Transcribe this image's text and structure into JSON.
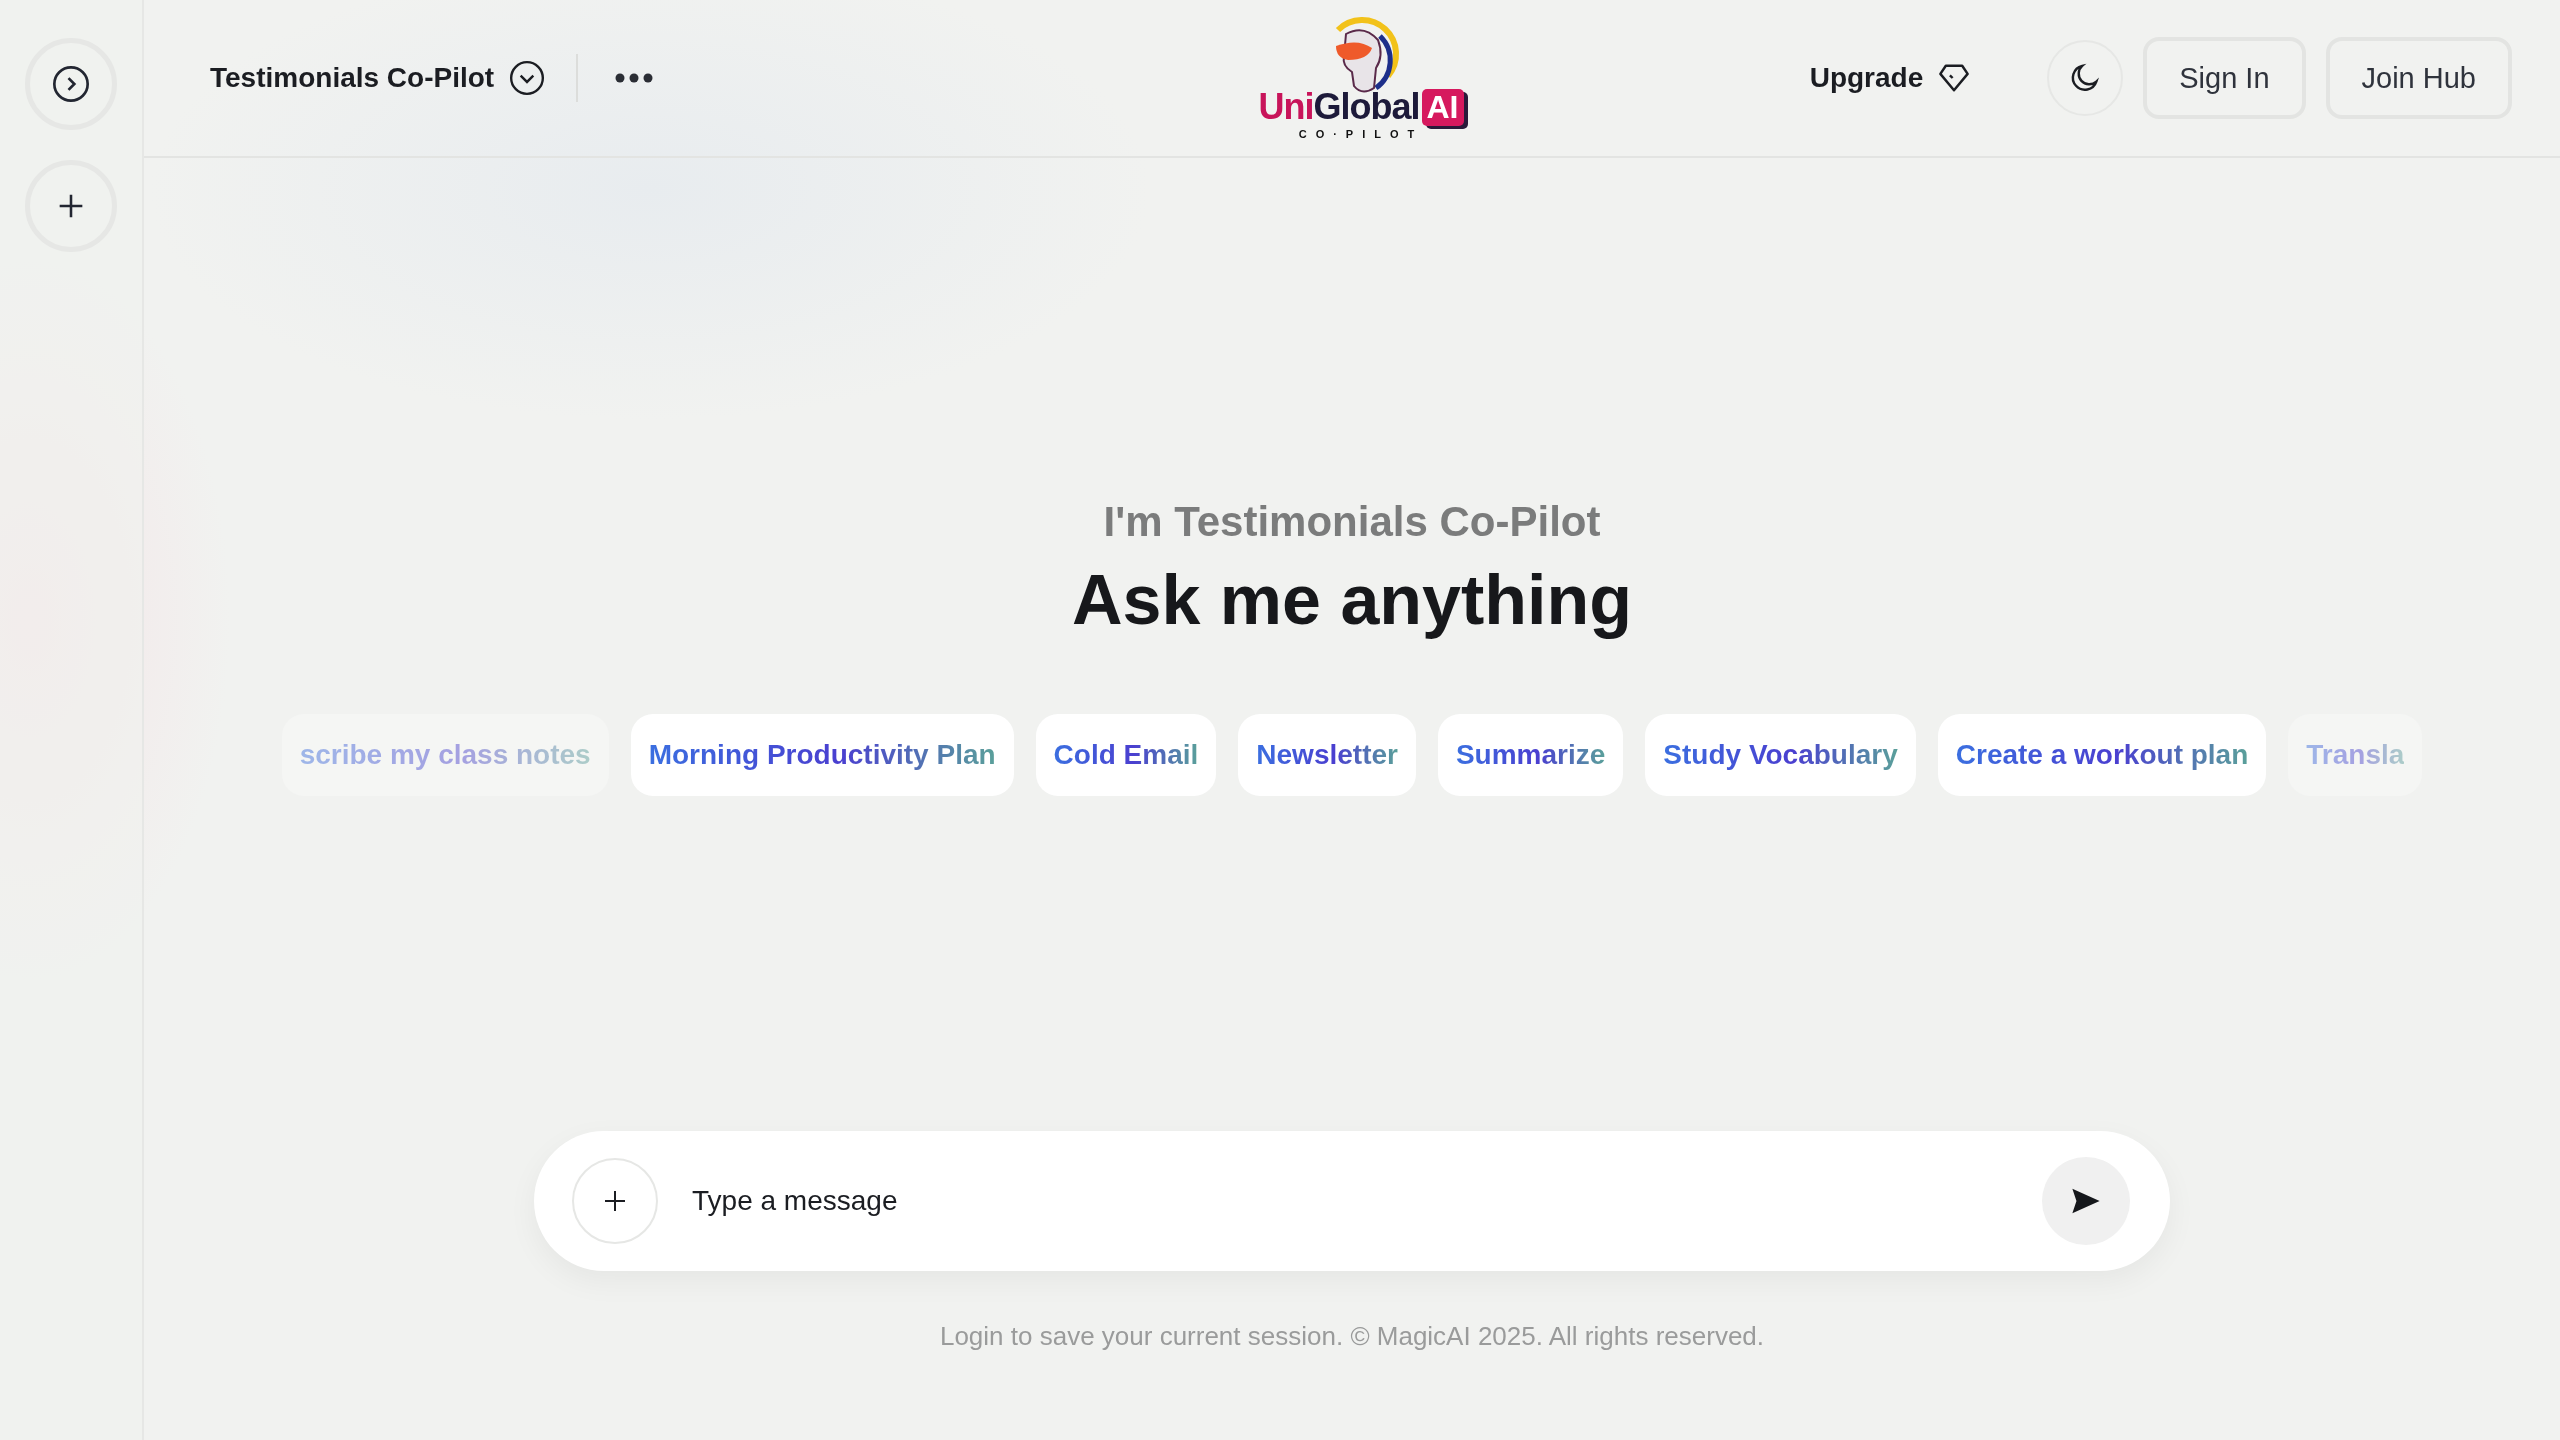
{
  "header": {
    "assistant_name": "Testimonials Co-Pilot",
    "logo": {
      "name": "UniGlobal",
      "badge": "AI",
      "tagline": "CO·PILOT"
    },
    "upgrade": "Upgrade",
    "sign_in": "Sign In",
    "join": "Join Hub"
  },
  "hero": {
    "subtitle": "I'm Testimonials Co-Pilot",
    "title": "Ask me anything"
  },
  "suggestions": [
    {
      "label": "scribe my class notes",
      "faded": true
    },
    {
      "label": "Morning Productivity Plan",
      "faded": false
    },
    {
      "label": "Cold Email",
      "faded": false
    },
    {
      "label": "Newsletter",
      "faded": false
    },
    {
      "label": "Summarize",
      "faded": false
    },
    {
      "label": "Study Vocabulary",
      "faded": false
    },
    {
      "label": "Create a workout plan",
      "faded": false
    },
    {
      "label": "Transla",
      "faded": true
    }
  ],
  "composer": {
    "placeholder": "Type a message"
  },
  "footer": "Login to save your current session. © MagicAI 2025. All rights reserved."
}
